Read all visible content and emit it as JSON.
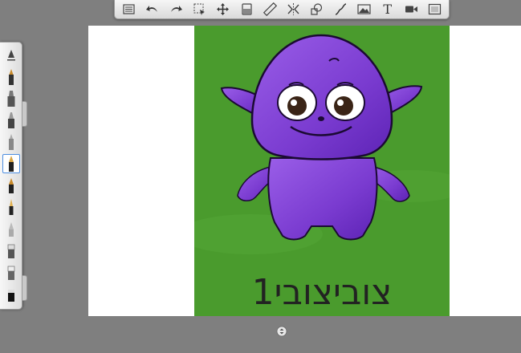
{
  "toolbar": {
    "tools": [
      {
        "name": "layers-icon"
      },
      {
        "name": "undo-icon"
      },
      {
        "name": "redo-icon"
      },
      {
        "name": "selection-icon"
      },
      {
        "name": "transform-icon"
      },
      {
        "name": "fill-icon"
      },
      {
        "name": "ruler-icon"
      },
      {
        "name": "symmetry-icon"
      },
      {
        "name": "shapes-icon"
      },
      {
        "name": "curve-icon"
      },
      {
        "name": "image-import-icon"
      },
      {
        "name": "text-tool-icon",
        "label": "T"
      },
      {
        "name": "video-record-icon"
      },
      {
        "name": "fullscreen-icon"
      }
    ]
  },
  "brushes": {
    "selected_index": 5,
    "items": [
      "brush-properties",
      "pencil",
      "marker",
      "paint-brush",
      "airbrush",
      "ink-pen",
      "pen",
      "fine-pen",
      "smudge",
      "blur",
      "eraser",
      "eraser-black"
    ]
  },
  "artwork": {
    "caption": "צוביצובי1",
    "background_color": "#4a9b2d",
    "character_color": "#7a3bd0"
  },
  "colors": {
    "workspace": "#7f7f7f",
    "canvas": "#ffffff",
    "selection_accent": "#4d8ee0"
  }
}
